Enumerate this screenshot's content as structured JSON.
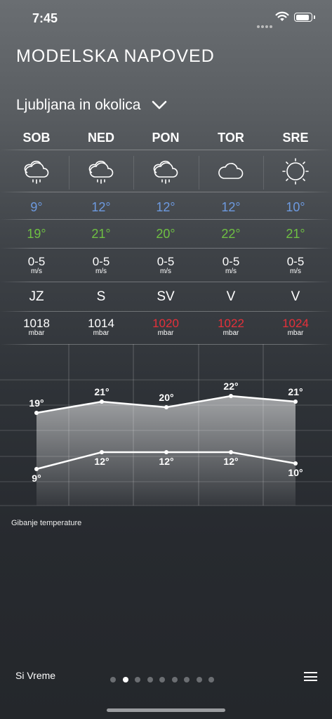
{
  "status_bar": {
    "time": "7:45"
  },
  "header": {
    "title": "MODELSKA NAPOVED",
    "location": "Ljubljana in okolica"
  },
  "days": [
    {
      "name": "SOB",
      "icon": "cloud-rain-icon",
      "min": "9°",
      "max": "19°",
      "wind": "0-5",
      "wind_unit": "m/s",
      "direction": "JZ",
      "pressure": "1018",
      "pressure_unit": "mbar",
      "pressure_color": "#ffffff"
    },
    {
      "name": "NED",
      "icon": "cloud-rain-icon",
      "min": "12°",
      "max": "21°",
      "wind": "0-5",
      "wind_unit": "m/s",
      "direction": "S",
      "pressure": "1014",
      "pressure_unit": "mbar",
      "pressure_color": "#ffffff"
    },
    {
      "name": "PON",
      "icon": "cloud-rain-icon",
      "min": "12°",
      "max": "20°",
      "wind": "0-5",
      "wind_unit": "m/s",
      "direction": "SV",
      "pressure": "1020",
      "pressure_unit": "mbar",
      "pressure_color": "#e5303a"
    },
    {
      "name": "TOR",
      "icon": "cloud-icon",
      "min": "12°",
      "max": "22°",
      "wind": "0-5",
      "wind_unit": "m/s",
      "direction": "V",
      "pressure": "1022",
      "pressure_unit": "mbar",
      "pressure_color": "#e5303a"
    },
    {
      "name": "SRE",
      "icon": "sun-icon",
      "min": "10°",
      "max": "21°",
      "wind": "0-5",
      "wind_unit": "m/s",
      "direction": "V",
      "pressure": "1024",
      "pressure_unit": "mbar",
      "pressure_color": "#e5303a"
    }
  ],
  "chart_data": {
    "type": "area",
    "categories": [
      "SOB",
      "NED",
      "PON",
      "TOR",
      "SRE"
    ],
    "series": [
      {
        "values": [
          19,
          21,
          20,
          22,
          21
        ]
      },
      {
        "values": [
          9,
          12,
          12,
          12,
          10
        ]
      }
    ],
    "ylim": [
      5,
      25
    ]
  },
  "chart": {
    "caption": "Gibanje temperature"
  },
  "footer": {
    "brand": "Si Vreme",
    "page_count": 9,
    "active_page": 1
  },
  "colors": {
    "min_temp": "#6d9ae0",
    "max_temp": "#6fc043",
    "high_pressure": "#e5303a"
  }
}
